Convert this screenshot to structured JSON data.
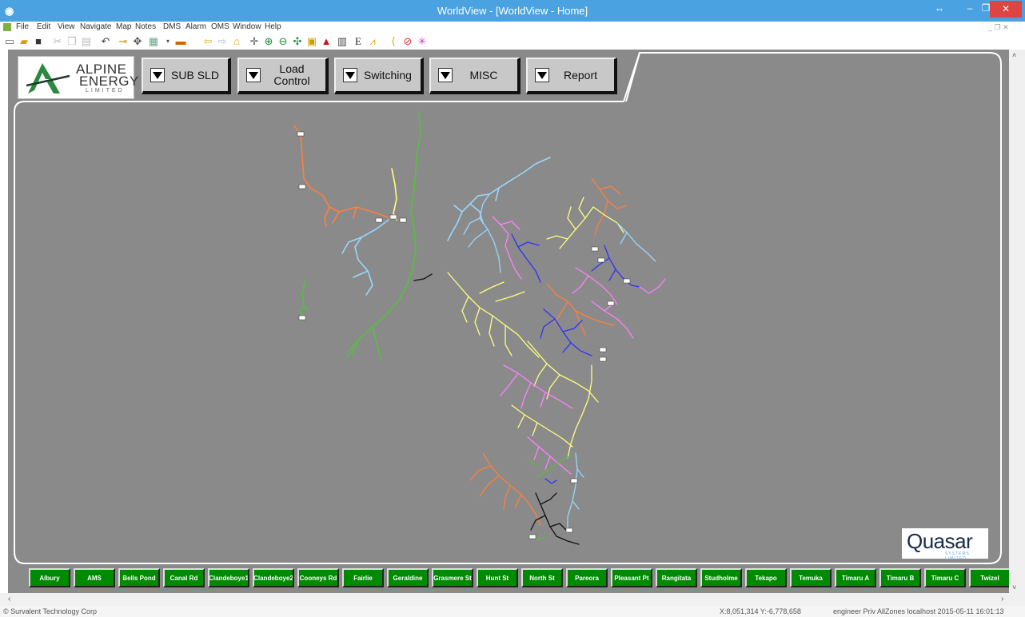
{
  "window": {
    "title": "WorldView - [WorldView - Home]",
    "app_icon": "app-icon",
    "controls": {
      "restore": "↔",
      "minimize": "–",
      "maximize": "❐",
      "close": "✕"
    }
  },
  "menu": {
    "items": [
      "File",
      "Edit",
      "View",
      "Navigate",
      "Map",
      "Notes",
      "DMS",
      "Alarm",
      "OMS",
      "Window",
      "Help"
    ],
    "mdi_controls": "_ ❐ ✕"
  },
  "toolbar": {
    "icons": [
      "new-icon",
      "open-icon",
      "save-icon",
      "cut-icon",
      "copy-icon",
      "paste-icon",
      "undo-icon",
      "connect-icon",
      "move-icon",
      "layers-icon",
      "dropdown-icon",
      "map-icon",
      "back-arrow-icon",
      "forward-arrow-icon",
      "home-icon",
      "crosshair-icon",
      "zoom-in-icon",
      "zoom-out-icon",
      "pan-icon",
      "folder-icon",
      "alarm-bell-icon",
      "table-icon",
      "text-e-icon",
      "chart-icon",
      "clear-icon",
      "settings-icon",
      "star-icon"
    ]
  },
  "header": {
    "logo": {
      "line1": "ALPINE",
      "line2": "ENERGY",
      "line3": "LIMITED"
    },
    "buttons": [
      {
        "label": "SUB SLD"
      },
      {
        "label": "Load\nControl"
      },
      {
        "label": "Switching"
      },
      {
        "label": "MISC"
      },
      {
        "label": "Report"
      }
    ]
  },
  "vendor_logo": {
    "name": "Quasar",
    "sub": "SYSTEMS LIMITED"
  },
  "substations": [
    "Albury",
    "AMS",
    "Bells Pond",
    "Canal Rd",
    "Clandeboye1",
    "Clandeboye2",
    "Cooneys Rd",
    "Fairlie",
    "Geraldine",
    "Grasmere St",
    "Hunt St",
    "North St",
    "Pareora",
    "Pleasant Pt",
    "Rangitata",
    "Studholme",
    "Tekapo",
    "Temuka",
    "Timaru A",
    "Timaru B",
    "Timaru C",
    "Twizel"
  ],
  "status": {
    "copyright": "© Survalent Technology Corp",
    "coords": "X:8,051,314 Y:-6,778,658",
    "session": "engineer  Priv  AllZones  localhost  2015-05-11 16:01:13"
  },
  "colors": {
    "titlebar": "#4aa3e0",
    "workspace": "#8a8a8a",
    "substation_button": "#008a00",
    "feeder_colors": [
      "#ff7f3f",
      "#9ad6ff",
      "#ffff80",
      "#ff80ff",
      "#3030ff",
      "#55c040",
      "#111111",
      "#e07050"
    ]
  }
}
